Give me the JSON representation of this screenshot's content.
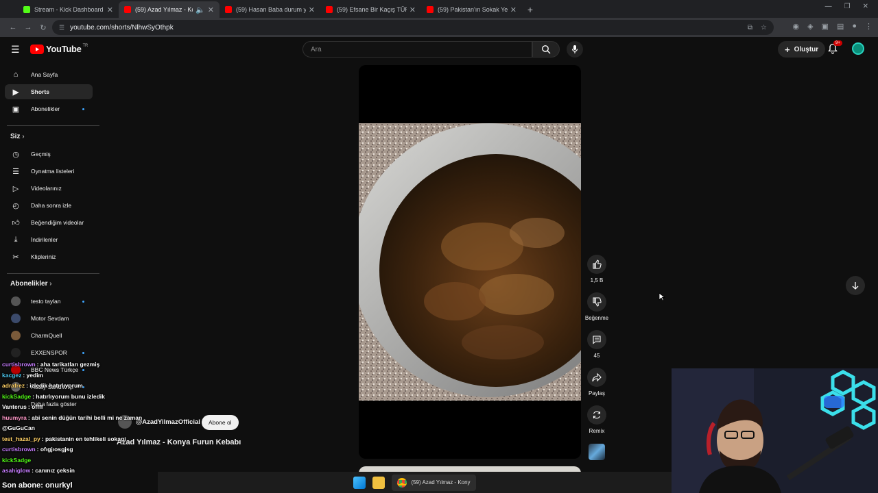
{
  "browser": {
    "tabs": [
      {
        "title": "Stream - Kick Dashboard",
        "color": "#53fc18",
        "active": false
      },
      {
        "title": "(59) Azad Yılmaz - Konya Fırın",
        "color": "#ff0000",
        "active": true
      },
      {
        "title": "(59) Hasan Baba durum yemeği",
        "color": "#ff0000",
        "active": false
      },
      {
        "title": "(59) Efsane Bir Kaçış TÜRKİYE'DE",
        "color": "#ff0000",
        "active": false
      },
      {
        "title": "(59) Pakistan'ın Sokak Yemekleri",
        "color": "#ff0000",
        "active": false
      }
    ],
    "url": "youtube.com/shorts/NlhwSyOthpk"
  },
  "youtube": {
    "logo_text": "YouTube",
    "logo_region": "TR",
    "search_placeholder": "Ara",
    "create_label": "Oluştur",
    "notification_count": "9+"
  },
  "sidebar": {
    "main": [
      {
        "label": "Ana Sayfa",
        "icon": "home-icon",
        "active": false
      },
      {
        "label": "Shorts",
        "icon": "shorts-icon",
        "active": true
      },
      {
        "label": "Abonelikler",
        "icon": "subscriptions-icon",
        "active": false,
        "dot": true
      }
    ],
    "you_header": "Siz",
    "you": [
      {
        "label": "Geçmiş",
        "icon": "history-icon"
      },
      {
        "label": "Oynatma listeleri",
        "icon": "playlist-icon"
      },
      {
        "label": "Videolarınız",
        "icon": "your-videos-icon"
      },
      {
        "label": "Daha sonra izle",
        "icon": "watch-later-icon"
      },
      {
        "label": "Beğendiğim videolar",
        "icon": "liked-icon"
      },
      {
        "label": "İndirilenler",
        "icon": "download-icon"
      },
      {
        "label": "Klipleriniz",
        "icon": "clips-icon"
      }
    ],
    "subs_header": "Abonelikler",
    "subscriptions": [
      {
        "label": "testo taylan",
        "dot": true,
        "color": "#555555"
      },
      {
        "label": "Motor Sevdam",
        "dot": false,
        "color": "#3b4a6b"
      },
      {
        "label": "CharmQuell",
        "dot": false,
        "color": "#7a5a3a"
      },
      {
        "label": "EXXENSPOR",
        "dot": true,
        "color": "#222222"
      },
      {
        "label": "BBC News Türkçe",
        "dot": true,
        "color": "#b80000"
      },
      {
        "label": "Hatay Sandık İçi",
        "dot": true,
        "color": "#6a6a6a"
      },
      {
        "label": "Daha fazla göster",
        "dot": false,
        "color": "#0f0f0f"
      }
    ]
  },
  "short": {
    "channel": "@AzadYilmazOfficial",
    "subscribe_label": "Abone ol",
    "title": "Azad Yılmaz - Konya Furun Kebabı",
    "likes": "1,5 B",
    "dislike_label": "Beğenme",
    "comments": "45",
    "share_label": "Paylaş",
    "remix_label": "Remix"
  },
  "chat": [
    {
      "user": "curtisbrown",
      "msg": ": aha tarikatları gezmiş",
      "color": "#c77dff"
    },
    {
      "user": "kacgez",
      "msg": ": yedim",
      "color": "#4cc9f0"
    },
    {
      "user": "adrafrez",
      "msg": ": izledik hatırlıyorum",
      "color": "#ffd166"
    },
    {
      "user": "kickSadge",
      "msg": ": hatırlıyorum bunu izledik",
      "color": "#53fc18"
    },
    {
      "user": "Vanterus",
      "msg": ": offff",
      "color": "#ffffff"
    },
    {
      "user": "huumyra",
      "msg": ": abi senin düğün tarihi belli mi ne zaman",
      "color": "#ff99c8"
    },
    {
      "user": "@GuGuCan",
      "msg": "",
      "color": "#ffffff"
    },
    {
      "user": "test_hazal_py",
      "msg": ": pakistanin en tehlikeli sokagi",
      "color": "#ffd166"
    },
    {
      "user": "curtisbrown",
      "msg": ": ofıgjıosgjsg",
      "color": "#c77dff"
    },
    {
      "user": "kickSadge",
      "msg": "",
      "color": "#53fc18"
    },
    {
      "user": "asahiglow",
      "msg": ": canınız çeksin",
      "color": "#c77dff"
    }
  ],
  "last_subscriber": "Son abone: onurkyl",
  "taskbar": {
    "chrome_label": "(59) Azad Yılmaz - Kony"
  }
}
